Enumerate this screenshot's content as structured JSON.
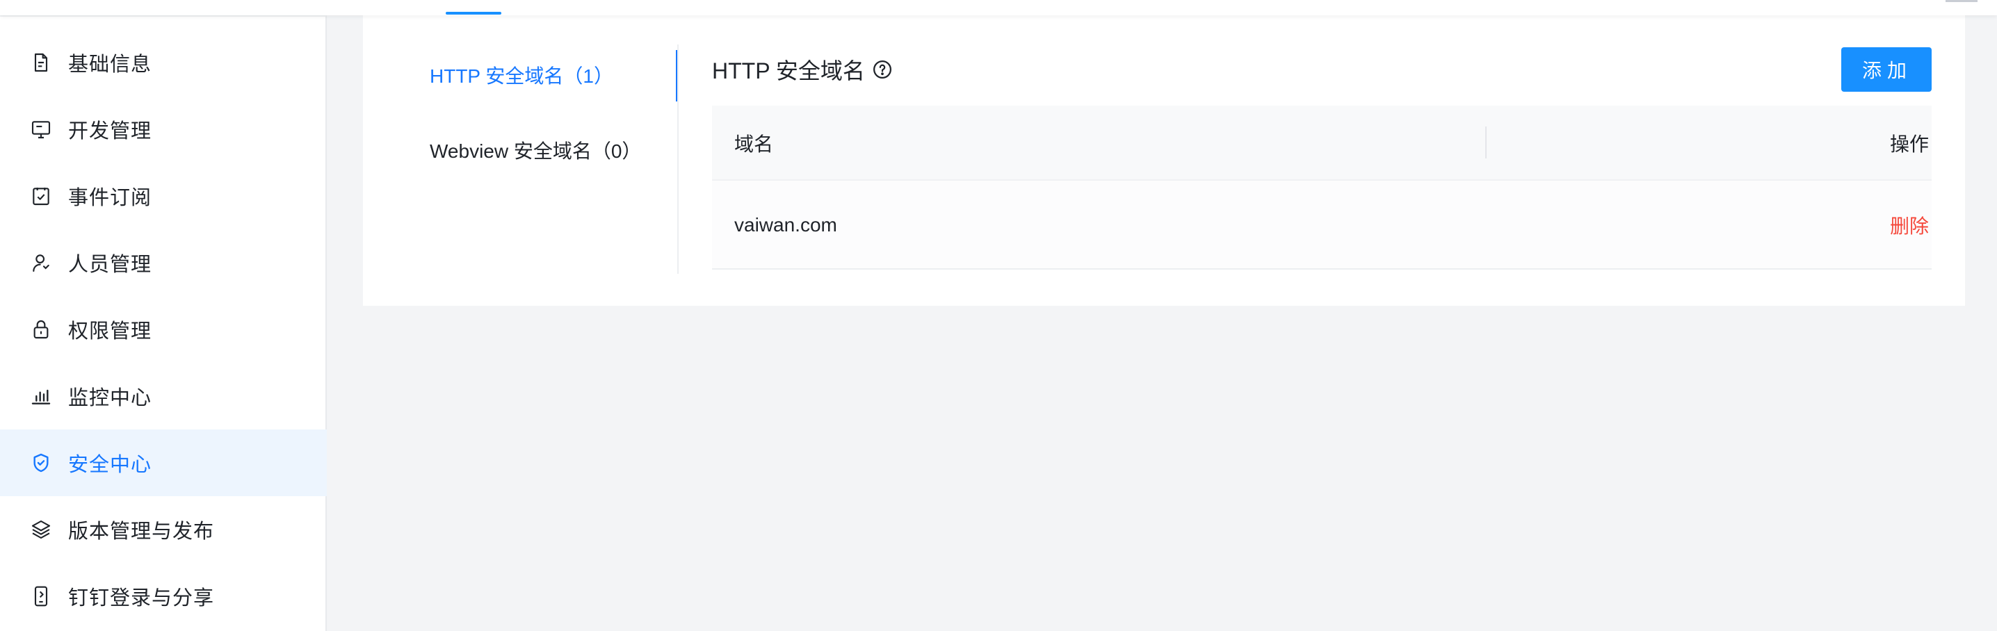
{
  "sidebar": {
    "items": [
      {
        "label": "基础信息",
        "icon": "document-icon",
        "active": false
      },
      {
        "label": "开发管理",
        "icon": "monitor-icon",
        "active": false
      },
      {
        "label": "事件订阅",
        "icon": "checklist-icon",
        "active": false
      },
      {
        "label": "人员管理",
        "icon": "user-icon",
        "active": false
      },
      {
        "label": "权限管理",
        "icon": "lock-icon",
        "active": false
      },
      {
        "label": "监控中心",
        "icon": "bar-chart-icon",
        "active": false
      },
      {
        "label": "安全中心",
        "icon": "shield-icon",
        "active": true
      },
      {
        "label": "版本管理与发布",
        "icon": "layers-icon",
        "active": false
      },
      {
        "label": "钉钉登录与分享",
        "icon": "phone-share-icon",
        "active": false
      }
    ]
  },
  "tabs": [
    {
      "label": "HTTP 安全域名（1）",
      "active": true
    },
    {
      "label": "Webview 安全域名（0）",
      "active": false
    }
  ],
  "panel": {
    "title": "HTTP 安全域名",
    "add_label": "添加"
  },
  "table": {
    "columns": [
      "域名",
      "操作"
    ],
    "rows": [
      {
        "domain": "vaiwan.com",
        "action": "删除"
      }
    ]
  },
  "colors": {
    "accent": "#1677ff",
    "button": "#1890ff",
    "danger": "#f5483b",
    "active_bg": "#edf5fe"
  }
}
